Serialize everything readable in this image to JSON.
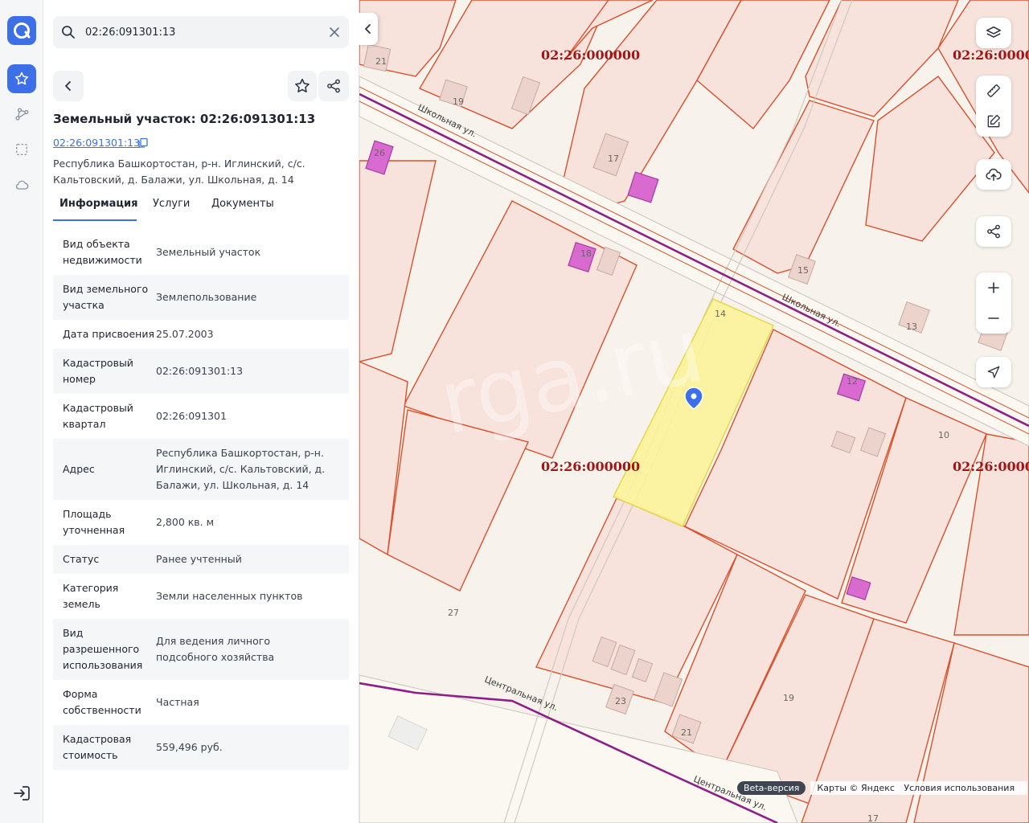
{
  "search": {
    "value": "02:26:091301:13"
  },
  "card": {
    "title": "Земельный участок: 02:26:091301:13",
    "cad_link": "02:26:091301:13",
    "address": "Республика Башкортостан, р-н. Иглинский, с/с. Кальтовский, д. Балажи, ул. Школьная, д. 14"
  },
  "tabs": [
    {
      "label": "Информация"
    },
    {
      "label": "Услуги"
    },
    {
      "label": "Документы"
    }
  ],
  "info_rows": [
    {
      "k": "Вид объекта недвижимости",
      "v": "Земельный участок"
    },
    {
      "k": "Вид земельного участка",
      "v": "Землепользование"
    },
    {
      "k": "Дата присвоения",
      "v": "25.07.2003"
    },
    {
      "k": "Кадастровый номер",
      "v": "02:26:091301:13"
    },
    {
      "k": "Кадастровый квартал",
      "v": "02:26:091301"
    },
    {
      "k": "Адрес",
      "v": "Республика Башкортостан, р-н. Иглинский, с/с. Кальтовский, д. Балажи, ул. Школьная, д. 14"
    },
    {
      "k": "Площадь уточненная",
      "v": "2,800 кв. м"
    },
    {
      "k": "Статус",
      "v": "Ранее учтенный"
    },
    {
      "k": "Категория земель",
      "v": "Земли населенных пунктов"
    },
    {
      "k": "Вид разрешенного использования",
      "v": "Для ведения личного подсобного хозяйства"
    },
    {
      "k": "Форма собственности",
      "v": "Частная"
    },
    {
      "k": "Кадастровая стоимость",
      "v": "559,496 руб."
    }
  ],
  "map": {
    "quarter_labels": [
      "02:26:000000",
      "02:26:000000",
      "02:26:000000",
      "02:26:000000"
    ],
    "street_labels": [
      "Школьная ул.",
      "Школьная ул.",
      "Центральная ул.",
      "Центральная ул."
    ],
    "house_numbers": [
      "21",
      "19",
      "26",
      "17",
      "18",
      "15",
      "14",
      "13",
      "12",
      "10",
      "27",
      "23",
      "21",
      "19",
      "17"
    ],
    "watermark": "rga.ru",
    "attribution": {
      "beta": "Beta-версия",
      "maps": "Карты © Яндекс",
      "terms": "Условия использования"
    }
  },
  "icons": {
    "logo": "app-logo-icon",
    "favorites": "star-icon",
    "routes": "nodes-icon",
    "area": "selection-icon",
    "cloud": "cloud-icon",
    "logout": "logout-icon",
    "layers": "layers-icon",
    "ruler": "ruler-icon",
    "edit": "edit-icon",
    "upload": "upload-cloud-icon",
    "share": "share-icon",
    "zoom_in": "plus-icon",
    "zoom_out": "minus-icon",
    "locate": "navigation-arrow-icon"
  },
  "colors": {
    "accent": "#3d6fe8",
    "parcel_border": "#d9512c",
    "parcel_fill": "#f7e2dc",
    "selected_parcel": "#fbf39a",
    "building": "#d96ad0",
    "road": "#8e1f86",
    "quarter_label": "#a01515"
  }
}
